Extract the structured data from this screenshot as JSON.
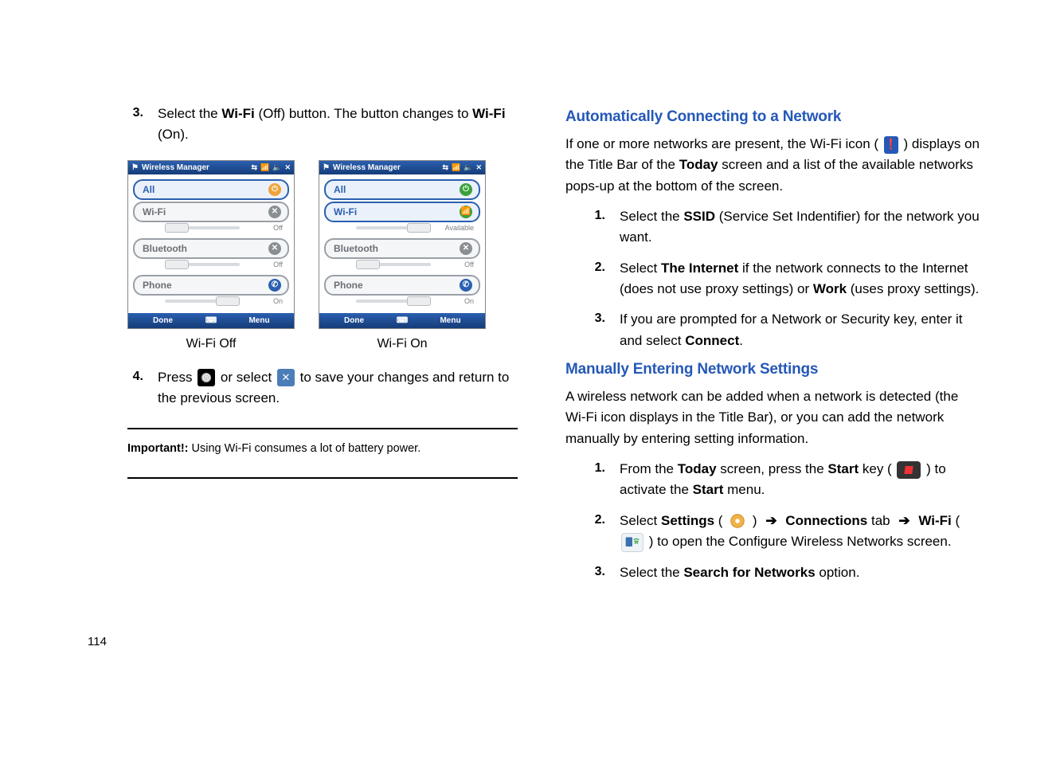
{
  "page_number": "114",
  "left": {
    "step3_num": "3.",
    "step3_a": "Select the ",
    "step3_b": "Wi-Fi",
    "step3_c": " (Off) button. The button changes to ",
    "step3_d": "Wi-Fi",
    "step3_e": "(On).",
    "caption_off": "Wi-Fi Off",
    "caption_on": "Wi-Fi On",
    "step4_num": "4.",
    "step4_a": "Press ",
    "step4_b": " or select ",
    "step4_c": " to save your changes and return to the previous screen.",
    "important_label": "Important!:",
    "important_text": " Using Wi-Fi consumes a lot of battery power."
  },
  "phone": {
    "title": "Wireless Manager",
    "tray_items": [
      "⇆",
      "📶",
      "🔈",
      "✕"
    ],
    "all": "All",
    "wifi": "Wi-Fi",
    "bluetooth": "Bluetooth",
    "phone": "Phone",
    "off": "Off",
    "on": "On",
    "available": "Available",
    "done": "Done",
    "menu": "Menu"
  },
  "right": {
    "h1": "Automatically Connecting to a Network",
    "p1_a": "If one or more networks are present, the Wi-Fi icon (",
    "p1_b": ") displays on the Title Bar of the ",
    "p1_c": "Today",
    "p1_d": " screen and a list of the available networks pops-up at the bottom of the screen.",
    "a1_num": "1.",
    "a1_a": "Select the ",
    "a1_b": "SSID",
    "a1_c": " (Service Set Indentifier) for the network you want.",
    "a2_num": "2.",
    "a2_a": "Select ",
    "a2_b": "The Internet",
    "a2_c": " if the network connects to the Internet (does not use proxy settings) or ",
    "a2_d": "Work",
    "a2_e": " (uses proxy settings).",
    "a3_num": "3.",
    "a3_a": "If you are prompted for a Network or Security key, enter it and select ",
    "a3_b": "Connect",
    "a3_c": ".",
    "h2": "Manually Entering Network Settings",
    "p2": "A wireless network can be added when a network is detected (the Wi-Fi icon displays in the Title Bar), or you can add the network manually by entering setting information.",
    "m1_num": "1.",
    "m1_a": "From the ",
    "m1_b": "Today",
    "m1_c": " screen, press the ",
    "m1_d": "Start",
    "m1_e": " key (",
    "m1_f": ") to activate the ",
    "m1_g": "Start",
    "m1_h": " menu.",
    "m2_num": "2.",
    "m2_a": "Select ",
    "m2_b": "Settings",
    "m2_c": " (",
    "m2_d": ")",
    "m2_e": "Connections",
    "m2_f": " tab",
    "m2_g": "Wi-Fi",
    "m2_h": " (",
    "m2_i": ") to open the Configure Wireless Networks screen.",
    "m3_num": "3.",
    "m3_a": "Select the ",
    "m3_b": "Search for Networks",
    "m3_c": " option."
  }
}
